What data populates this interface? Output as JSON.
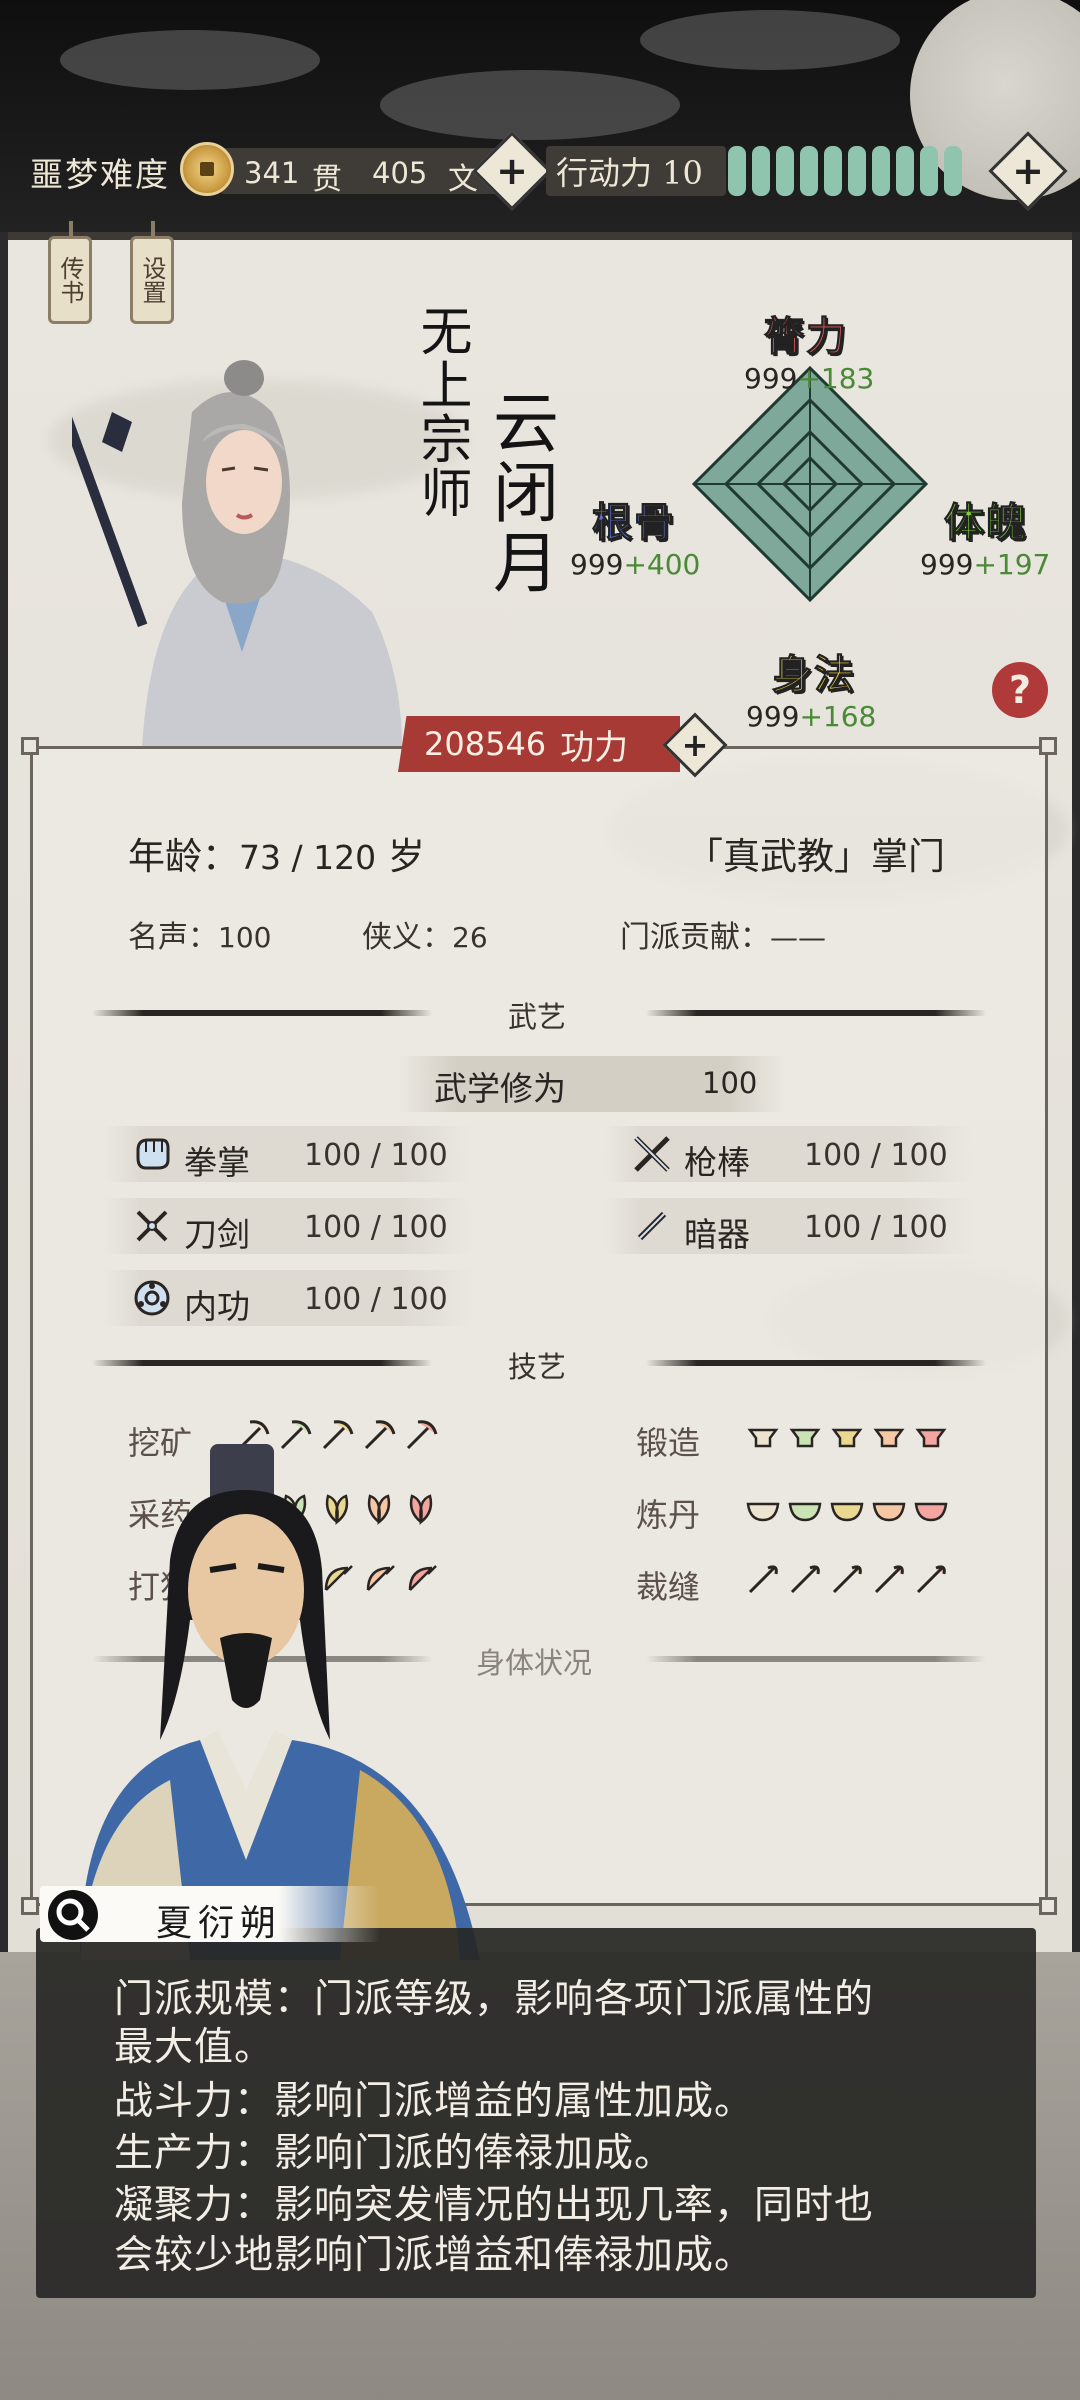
{
  "topbar": {
    "difficulty": "噩梦难度",
    "money_guan": "341",
    "money_guan_unit": "贯",
    "money_wen": "405",
    "money_wen_unit": "文",
    "action_label": "行动力 10",
    "action_points": 10,
    "energy_bar_count": 10,
    "plus_symbol": "+"
  },
  "bookmarks": {
    "biography": "传书",
    "settings": "设置"
  },
  "character": {
    "sect_title": "无上宗师",
    "name": "云闭月",
    "power_value": "208546",
    "power_label": "功力",
    "help_symbol": "?"
  },
  "attributes": {
    "strength": {
      "label": "膂力",
      "base": "999",
      "bonus": "+183",
      "color": "#e25b57"
    },
    "constitution": {
      "label": "体魄",
      "base": "999",
      "bonus": "+197",
      "color": "#7fd13b"
    },
    "root": {
      "label": "根骨",
      "base": "999",
      "bonus": "+400",
      "color": "#5b6fd6"
    },
    "agility": {
      "label": "身法",
      "base": "999",
      "bonus": "+168",
      "color": "#f1d23c"
    }
  },
  "profile": {
    "age_label": "年龄：",
    "age_value": "73 / 120",
    "age_unit": "岁",
    "role": "「真武教」掌门",
    "fame_label": "名声：",
    "fame_value": "100",
    "chivalry_label": "侠义：",
    "chivalry_value": "26",
    "contribution_label": "门派贡献：",
    "contribution_value": "——"
  },
  "martial": {
    "section_title": "武艺",
    "cultivation_label": "武学修为",
    "cultivation_value": "100",
    "skills": [
      {
        "name": "拳掌",
        "value": "100 / 100",
        "icon": "fist-icon"
      },
      {
        "name": "枪棒",
        "value": "100 / 100",
        "icon": "spear-icon"
      },
      {
        "name": "刀剑",
        "value": "100 / 100",
        "icon": "sword-icon"
      },
      {
        "name": "暗器",
        "value": "100 / 100",
        "icon": "dart-icon"
      },
      {
        "name": "内功",
        "value": "100 / 100",
        "icon": "inner-energy-icon"
      }
    ]
  },
  "crafts": {
    "section_title": "技艺",
    "items": [
      {
        "name": "挖矿",
        "icon": "pickaxe-icon",
        "level": 5
      },
      {
        "name": "锻造",
        "icon": "anvil-icon",
        "level": 5
      },
      {
        "name": "采药",
        "icon": "herb-icon",
        "level": 5
      },
      {
        "name": "炼丹",
        "icon": "bowl-icon",
        "level": 5
      },
      {
        "name": "打猎",
        "icon": "bow-icon",
        "level": 5
      },
      {
        "name": "裁缝",
        "icon": "needle-icon",
        "level": 5
      }
    ]
  },
  "body_status": {
    "section_title": "身体状况"
  },
  "dialog": {
    "speaker": "夏衍朔",
    "lines": [
      "门派规模：门派等级，影响各项门派属性的",
      "最大值。",
      "战斗力：影响门派增益的属性加成。",
      "生产力：影响门派的俸禄加成。",
      "凝聚力：影响突发情况的出现几率，同时也",
      "会较少地影响门派增益和俸禄加成。"
    ]
  }
}
